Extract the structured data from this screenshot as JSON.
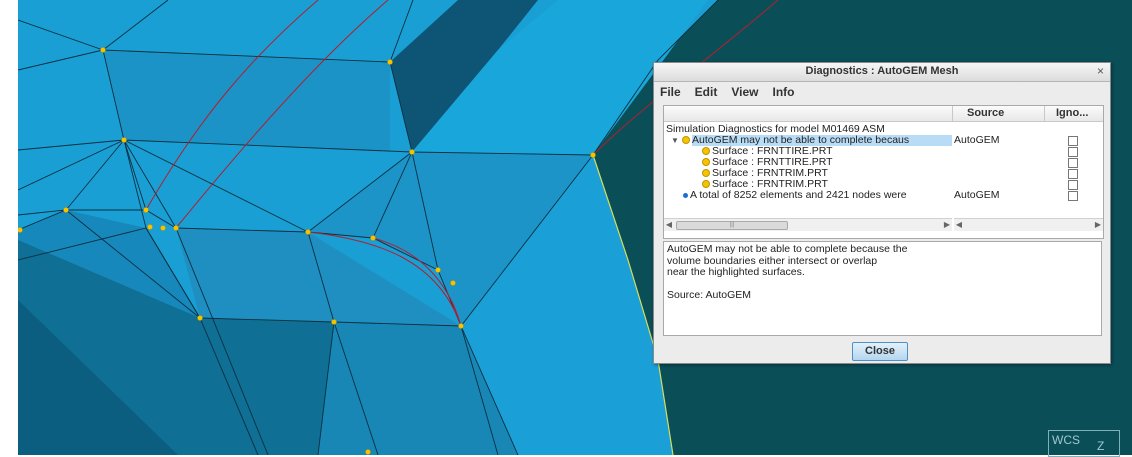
{
  "dialog": {
    "title": "Diagnostics : AutoGEM Mesh",
    "close_glyph": "×",
    "menu": [
      "File",
      "Edit",
      "View",
      "Info"
    ],
    "columns": {
      "source": "Source",
      "ignore": "Igno..."
    },
    "root_label": "Simulation Diagnostics for model M01469 ASM",
    "items": [
      {
        "text": "AutoGEM may not be able to complete becaus",
        "source": "AutoGEM",
        "icon": "warning-dot-yellow",
        "selected": true,
        "expanded": true
      },
      {
        "text": "Surface : FRNTTIRE.PRT",
        "source": "",
        "icon": "warning-dot-yellow"
      },
      {
        "text": "Surface : FRNTTIRE.PRT",
        "source": "",
        "icon": "warning-dot-yellow"
      },
      {
        "text": "Surface : FRNTRIM.PRT",
        "source": "",
        "icon": "warning-dot-yellow"
      },
      {
        "text": "Surface : FRNTRIM.PRT",
        "source": "",
        "icon": "warning-dot-yellow"
      },
      {
        "text": "A total of 8252 elements and 2421 nodes were",
        "source": "AutoGEM",
        "icon": "info-dot-blue"
      }
    ],
    "message_lines": [
      "AutoGEM may not be able to complete because the",
      "volume boundaries either intersect or overlap",
      "near the highlighted surfaces.",
      "",
      "Source: AutoGEM"
    ],
    "close_button": "Close"
  },
  "viewport": {
    "wcs_label": "WCS",
    "axis_label": "Z"
  },
  "colors": {
    "mesh_light": "#19a8dc",
    "mesh_mid": "#1b8fbd",
    "mesh_dark": "#0f5c7c",
    "teal": "#0a4f57",
    "node": "#f5c400",
    "highlight_edge": "#b02030"
  }
}
